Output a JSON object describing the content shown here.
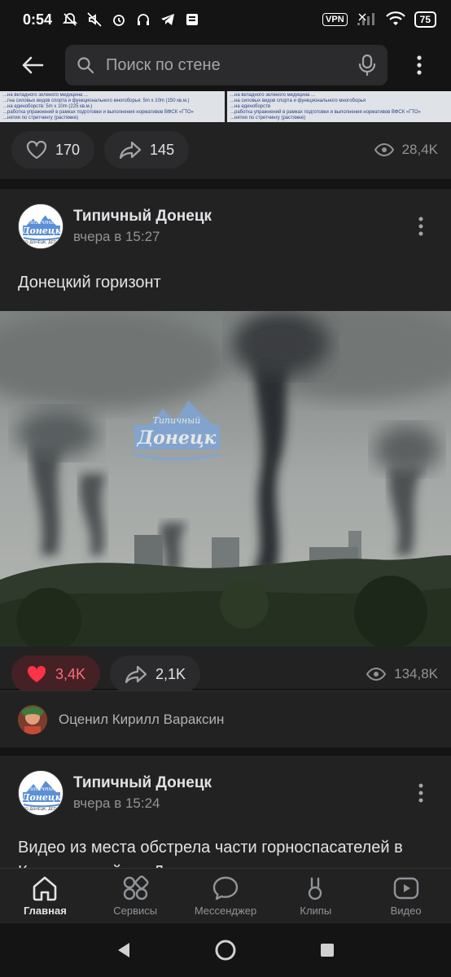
{
  "status_bar": {
    "time": "0:54",
    "vpn": "VPN",
    "battery": "75"
  },
  "search": {
    "placeholder": "Поиск по стене"
  },
  "prev_post": {
    "doc_left": [
      "...на вкладного зеленого медицина ...",
      "...гна силовых видов спорта и функционального многоборья: 5m x 10m (150 кв.м.)",
      "...на единоборств: 5m x 10m (225 кв.м.)",
      "...работка упражнений в рамках подготовки и выполнения нормативов ВФСК «ГТО»",
      "...нятия по стретчингу (растяжке)"
    ],
    "doc_right": [
      "...на вкладного зеленого медицина ...",
      "...на силовых видов спорта и функционального многоборья",
      "...на единоборств",
      "...работка упражнений в рамках подготовки и выполнения нормативов ВФСК «ГТО»",
      "...нятия по стретчингу (растяжке)"
    ],
    "likes": "170",
    "shares": "145",
    "views": "28,4K"
  },
  "post1": {
    "author": "Типичный Донецк",
    "date": "вчера в 15:27",
    "text": "Донецкий горизонт",
    "watermark_top": "Типичный",
    "watermark_main": "Донецк",
    "likes": "3,4K",
    "shares": "2,1K",
    "views": "134,8K",
    "liked_by": "Оценил Кирилл Вараксин"
  },
  "post2": {
    "author": "Типичный Донецк",
    "date": "вчера в 15:24",
    "text": "Видео из места обстрела части горноспасателей в Киевском районе Донецка сегодня"
  },
  "avatar_logo": {
    "top": "Типичный",
    "main": "Донецк",
    "sub": "ЕТО ДОНЕЦК, ДЕТКА!"
  },
  "tabs": [
    {
      "label": "Главная",
      "icon": "home-icon",
      "active": true
    },
    {
      "label": "Сервисы",
      "icon": "services-icon"
    },
    {
      "label": "Мессенджер",
      "icon": "messenger-icon"
    },
    {
      "label": "Клипы",
      "icon": "clips-icon"
    },
    {
      "label": "Видео",
      "icon": "video-icon"
    }
  ],
  "colors": {
    "background": "#141414",
    "card": "#222222",
    "like_active": "#ff3347",
    "accent_logo": "#5b8fd6"
  }
}
